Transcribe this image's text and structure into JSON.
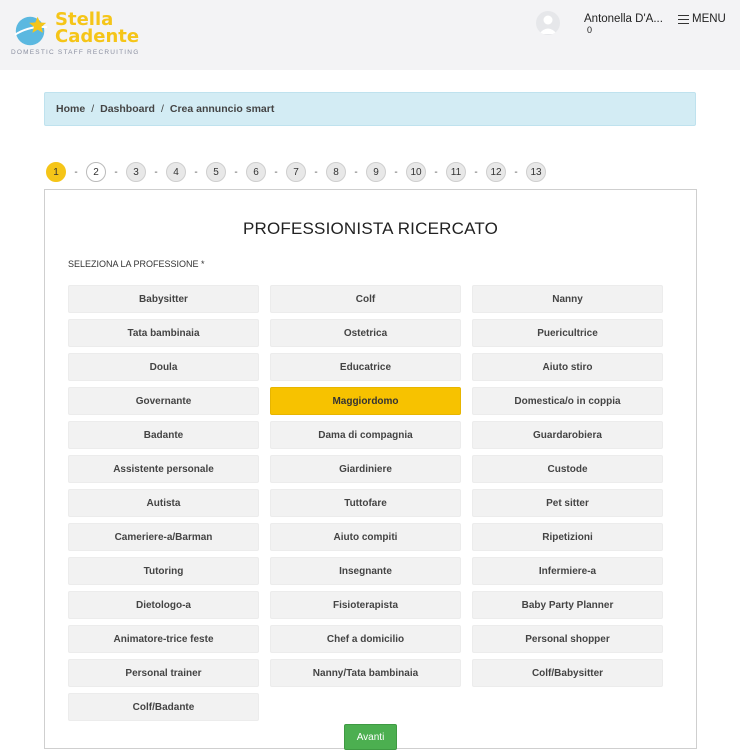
{
  "header": {
    "logo_line1": "Stella",
    "logo_line2": "Cadente",
    "logo_tagline": "DOMESTIC STAFF RECRUITING",
    "user_name": "Antonella D'A...",
    "user_count": "0",
    "menu_label": "MENU"
  },
  "breadcrumb": {
    "items": [
      "Home",
      "Dashboard",
      "Crea annuncio smart"
    ]
  },
  "steps": [
    "1",
    "2",
    "3",
    "4",
    "5",
    "6",
    "7",
    "8",
    "9",
    "10",
    "11",
    "12",
    "13"
  ],
  "form": {
    "title": "PROFESSIONISTA RICERCATO",
    "field_label": "SELEZIONA LA PROFESSIONE *",
    "selected": "Maggiordomo",
    "options": [
      "Babysitter",
      "Colf",
      "Nanny",
      "Tata bambinaia",
      "Ostetrica",
      "Puericultrice",
      "Doula",
      "Educatrice",
      "Aiuto stiro",
      "Governante",
      "Maggiordomo",
      "Domestica/o in coppia",
      "Badante",
      "Dama di compagnia",
      "Guardarobiera",
      "Assistente personale",
      "Giardiniere",
      "Custode",
      "Autista",
      "Tuttofare",
      "Pet sitter",
      "Cameriere-a/Barman",
      "Aiuto compiti",
      "Ripetizioni",
      "Tutoring",
      "Insegnante",
      "Infermiere-a",
      "Dietologo-a",
      "Fisioterapista",
      "Baby Party Planner",
      "Animatore-trice feste",
      "Chef a domicilio",
      "Personal shopper",
      "Personal trainer",
      "Nanny/Tata bambinaia",
      "Colf/Babysitter",
      "Colf/Badante"
    ],
    "next_label": "Avanti"
  },
  "colors": {
    "accent": "#f5c518",
    "selected": "#f7c200",
    "breadcrumb_bg": "#d3ecf4",
    "next_button": "#4caf50"
  },
  "icons": {
    "logo": "star-planet-logo",
    "avatar": "user-avatar-icon",
    "menu": "hamburger-icon"
  }
}
